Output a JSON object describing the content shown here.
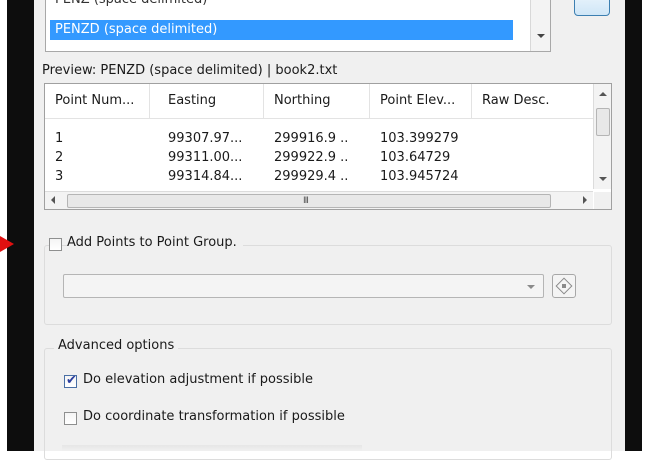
{
  "format_list": {
    "items": [
      "PENZ (space delimited)",
      "PENZD (space delimited)"
    ],
    "selected": "PENZD (space delimited)"
  },
  "preview": {
    "label": "Preview: PENZD (space delimited) | book2.txt"
  },
  "table": {
    "columns": [
      "Point Num...",
      "Easting",
      "Northing",
      "Point Elev...",
      "Raw Desc."
    ],
    "rows": [
      [
        "1",
        "99307.97...",
        "299916.9 ..",
        "103.399279"
      ],
      [
        "2",
        "99311.00...",
        "299922.9 ..",
        "103.64729"
      ],
      [
        "3",
        "99314.84...",
        "299929.4 ..",
        "103.945724"
      ]
    ],
    "scroll_grip": "III"
  },
  "point_group": {
    "checkbox_label": "Add Points to Point Group.",
    "checked": false,
    "combo_value": ""
  },
  "advanced": {
    "title": "Advanced options",
    "elevation_label": "Do elevation adjustment if possible",
    "elevation_checked": true,
    "transform_label": "Do coordinate transformation if possible",
    "transform_checked": false
  },
  "colors": {
    "selection": "#3399ff",
    "dialog_bg": "#f0f0f0",
    "indicator_arrow": "#e01010"
  }
}
